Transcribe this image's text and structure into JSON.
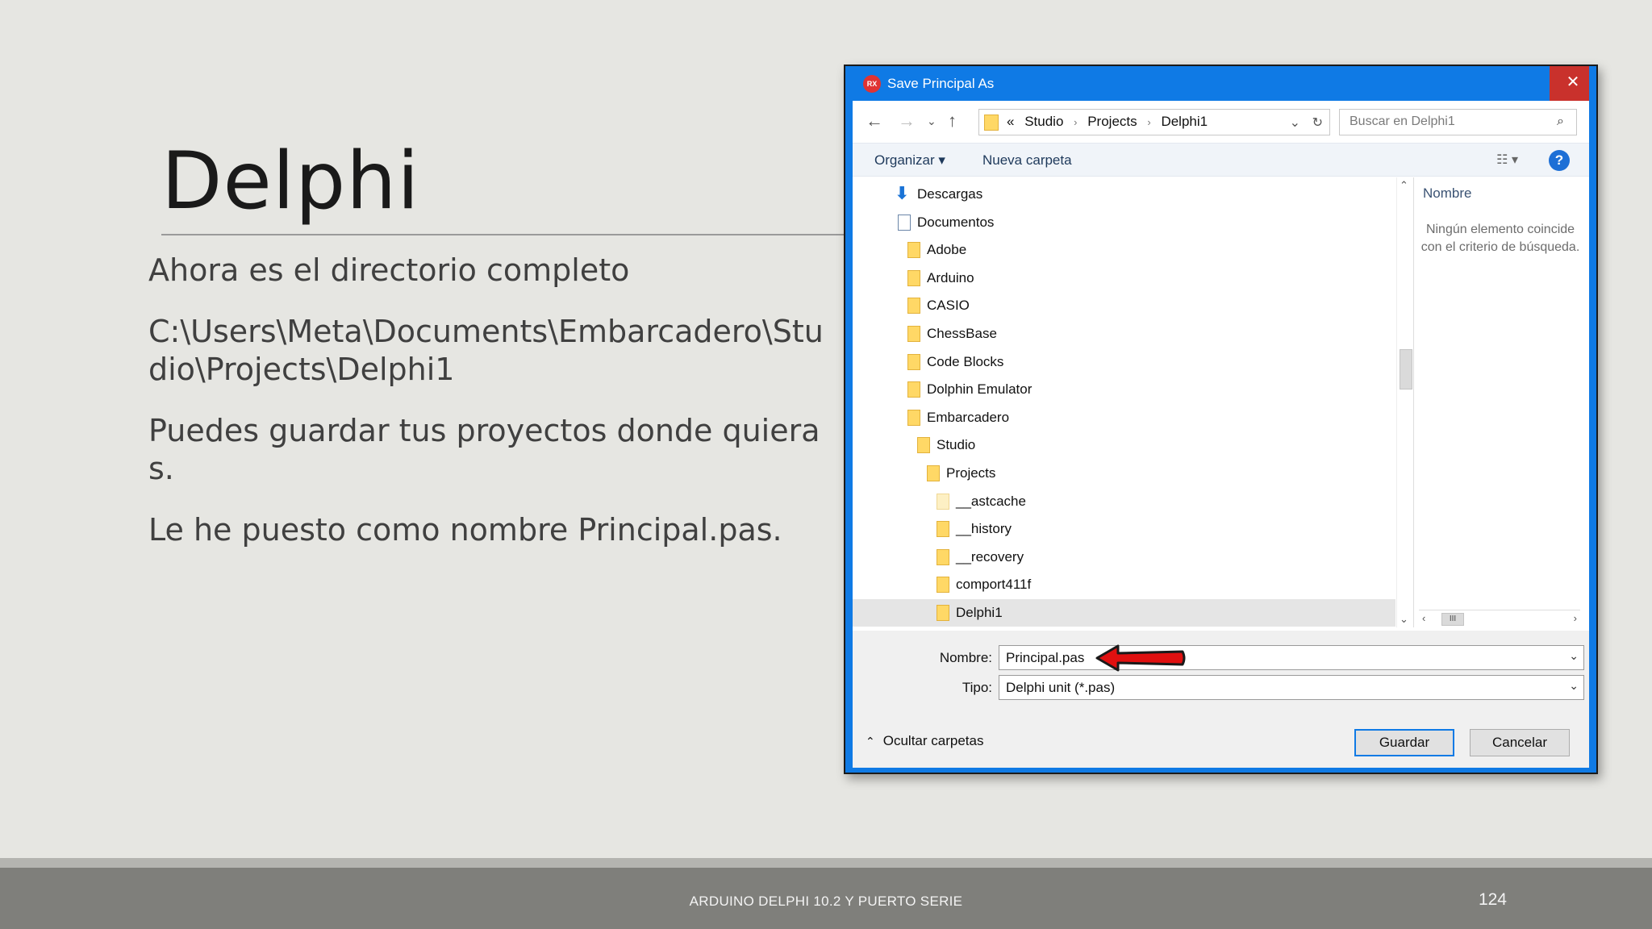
{
  "slide": {
    "title": "Delphi",
    "bullets": [
      "Ahora es el directorio completo",
      "C:\\Users\\Meta\\Documents\\Embarcadero\\Studio\\Projects\\Delphi1",
      "Puedes guardar tus proyectos donde quieras.",
      "Le he puesto como nombre Principal.pas."
    ],
    "footer": "ARDUINO DELPHI 10.2 Y PUERTO SERIE",
    "page_number": "124"
  },
  "dialog": {
    "app_icon": "RX",
    "title": "Save Principal As",
    "close": "✕",
    "address": {
      "prefix": "«",
      "crumbs": [
        "Studio",
        "Projects",
        "Delphi1"
      ]
    },
    "search_placeholder": "Buscar en Delphi1",
    "toolbar": {
      "organize": "Organizar ▾",
      "new_folder": "Nueva carpeta",
      "help": "?"
    },
    "tree": [
      {
        "label": "Descargas",
        "icon": "download-icon"
      },
      {
        "label": "Documentos",
        "icon": "document-icon"
      },
      {
        "label": "Adobe",
        "icon": "folder-icon"
      },
      {
        "label": "Arduino",
        "icon": "folder-icon"
      },
      {
        "label": "CASIO",
        "icon": "folder-icon"
      },
      {
        "label": "ChessBase",
        "icon": "folder-icon"
      },
      {
        "label": "Code Blocks",
        "icon": "folder-icon"
      },
      {
        "label": "Dolphin Emulator",
        "icon": "folder-icon"
      },
      {
        "label": "Embarcadero",
        "icon": "folder-icon"
      },
      {
        "label": "Studio",
        "icon": "folder-icon"
      },
      {
        "label": "Projects",
        "icon": "folder-icon"
      },
      {
        "label": "__astcache",
        "icon": "folder-icon"
      },
      {
        "label": "__history",
        "icon": "folder-icon"
      },
      {
        "label": "__recovery",
        "icon": "folder-icon"
      },
      {
        "label": "comport411f",
        "icon": "folder-icon"
      },
      {
        "label": "Delphi1",
        "icon": "folder-icon",
        "selected": true
      }
    ],
    "right_pane": {
      "column": "Nombre",
      "empty_message": "Ningún elemento coincide con el criterio de búsqueda."
    },
    "filename_label": "Nombre:",
    "filename_value": "Principal.pas",
    "type_label": "Tipo:",
    "type_value": "Delphi unit (*.pas)",
    "hide_folders": "Ocultar carpetas",
    "save_button": "Guardar",
    "cancel_button": "Cancelar"
  },
  "colors": {
    "accent": "#0f7ae5",
    "close": "#c9312c",
    "annotation": "#e01010"
  }
}
